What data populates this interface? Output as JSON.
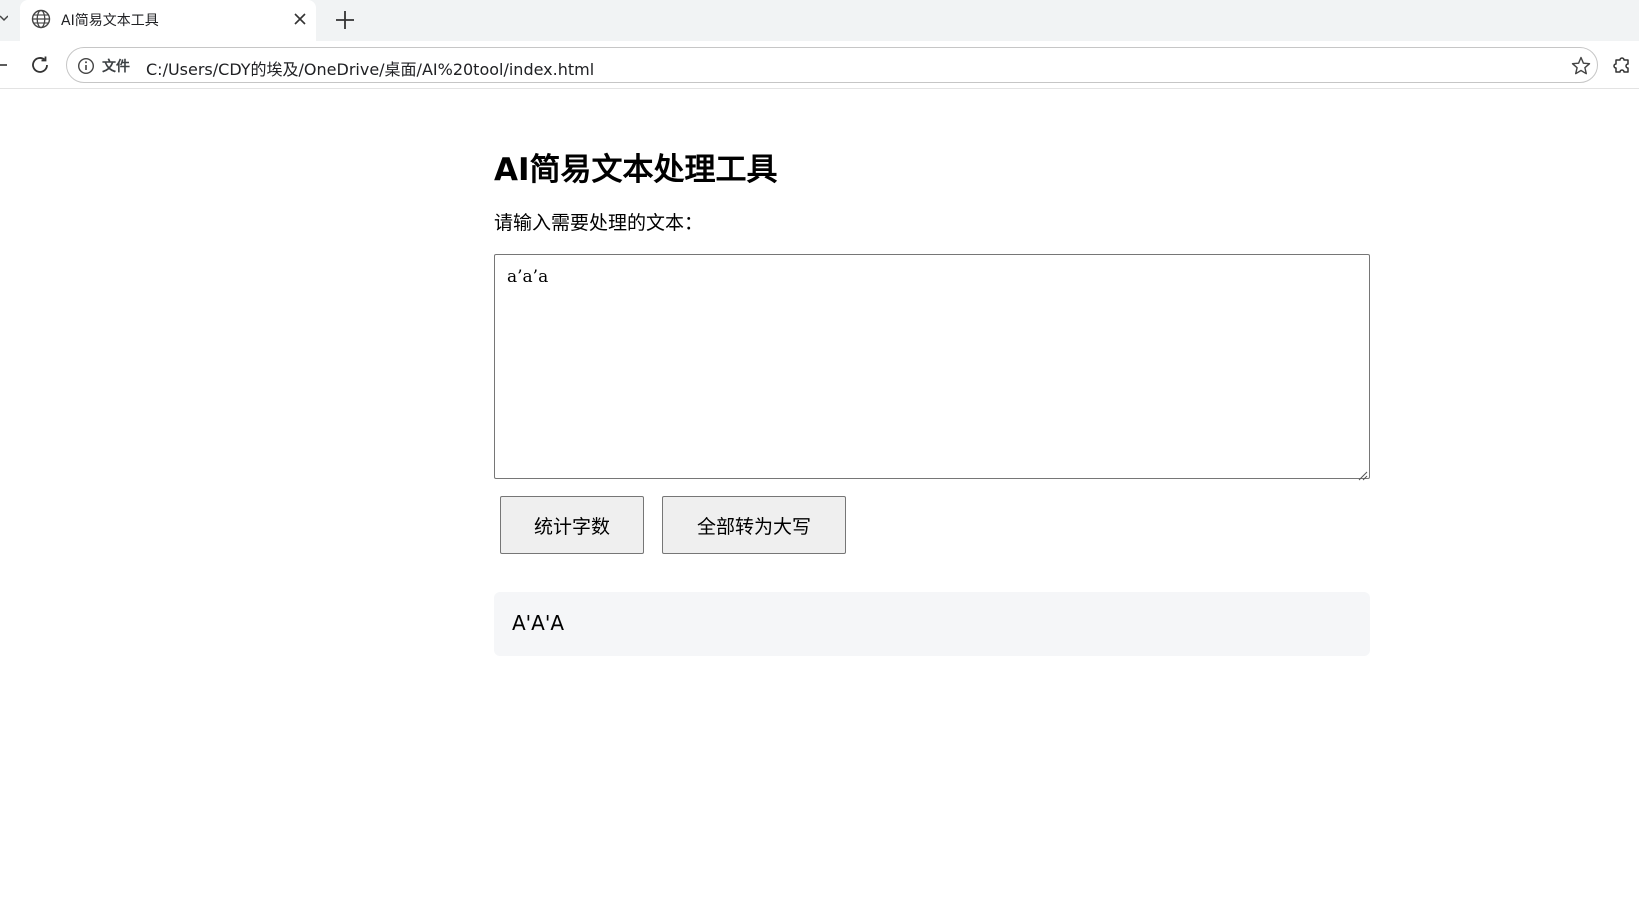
{
  "browser": {
    "tab": {
      "title": "AI简易文本工具",
      "favicon_icon": "globe-icon",
      "close_icon": "close-icon"
    },
    "new_tab_icon": "plus-icon",
    "toolbar": {
      "reload_icon": "reload-icon",
      "omnibox": {
        "security_icon": "info-icon",
        "scheme_label": "文件",
        "url": "C:/Users/CDY的埃及/OneDrive/桌面/AI%20tool/index.html",
        "bookmark_icon": "star-icon"
      },
      "extensions_icon": "puzzle-icon"
    }
  },
  "page": {
    "title": "AI简易文本处理工具",
    "input_label": "请输入需要处理的文本：",
    "input_value": "a’a’a",
    "buttons": {
      "count_label": "统计字数",
      "uppercase_label": "全部转为大写"
    },
    "result_text": "A'A'A"
  },
  "colors": {
    "tabstrip_bg": "#f1f3f4",
    "result_bg": "#f5f6f8",
    "button_bg": "#efefef"
  }
}
